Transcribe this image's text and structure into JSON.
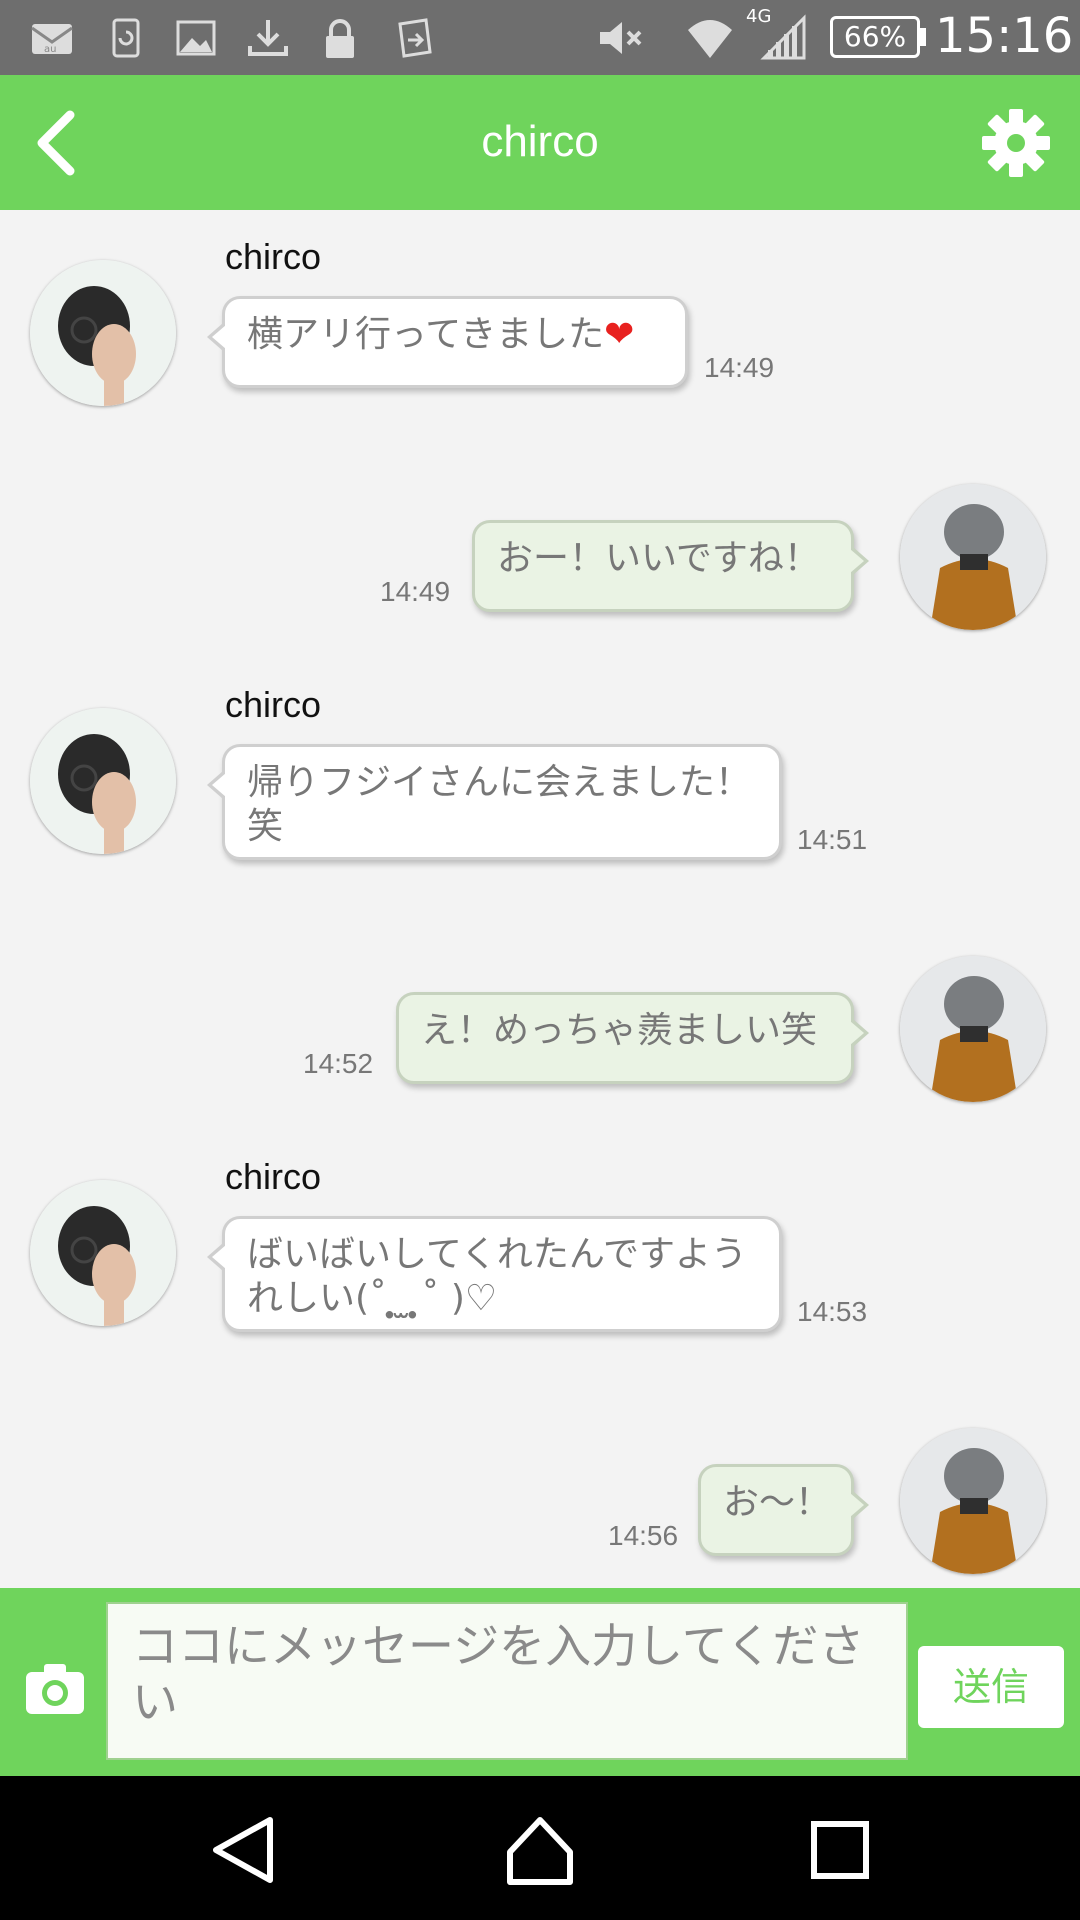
{
  "status_bar": {
    "battery": "66%",
    "network": "4G",
    "time": "15:16",
    "icons": [
      "mail-au-icon",
      "sync-icon",
      "image-icon",
      "download-icon",
      "lock-icon",
      "transfer-icon",
      "mute-icon",
      "wifi-icon",
      "signal-icon",
      "battery-icon"
    ]
  },
  "header": {
    "title": "chirco",
    "back_icon": "chevron-left-icon",
    "settings_icon": "gear-icon",
    "background": "#6fd45c"
  },
  "messages": [
    {
      "side": "in",
      "sender": "chirco",
      "text": "横アリ行ってきました",
      "emoji": "❤",
      "time": "14:49"
    },
    {
      "side": "out",
      "text": "おー！いいですね！",
      "time": "14:49"
    },
    {
      "side": "in",
      "sender": "chirco",
      "text": "帰りフジイさんに会えました！笑",
      "time": "14:51"
    },
    {
      "side": "out",
      "text": "え！めっちゃ羨ましい笑",
      "time": "14:52"
    },
    {
      "side": "in",
      "sender": "chirco",
      "text": "ばいばいしてくれたんですようれしい(˚ ̣̣̥ ̫ ̣̣̥˚ )♡",
      "time": "14:53"
    },
    {
      "side": "out",
      "text": "お〜！",
      "time": "14:56"
    }
  ],
  "composer": {
    "placeholder": "ココにメッセージを入力してください",
    "send_label": "送信",
    "camera_icon": "camera-icon"
  },
  "nav": {
    "icons": [
      "back-triangle-icon",
      "home-icon",
      "recents-icon"
    ]
  }
}
